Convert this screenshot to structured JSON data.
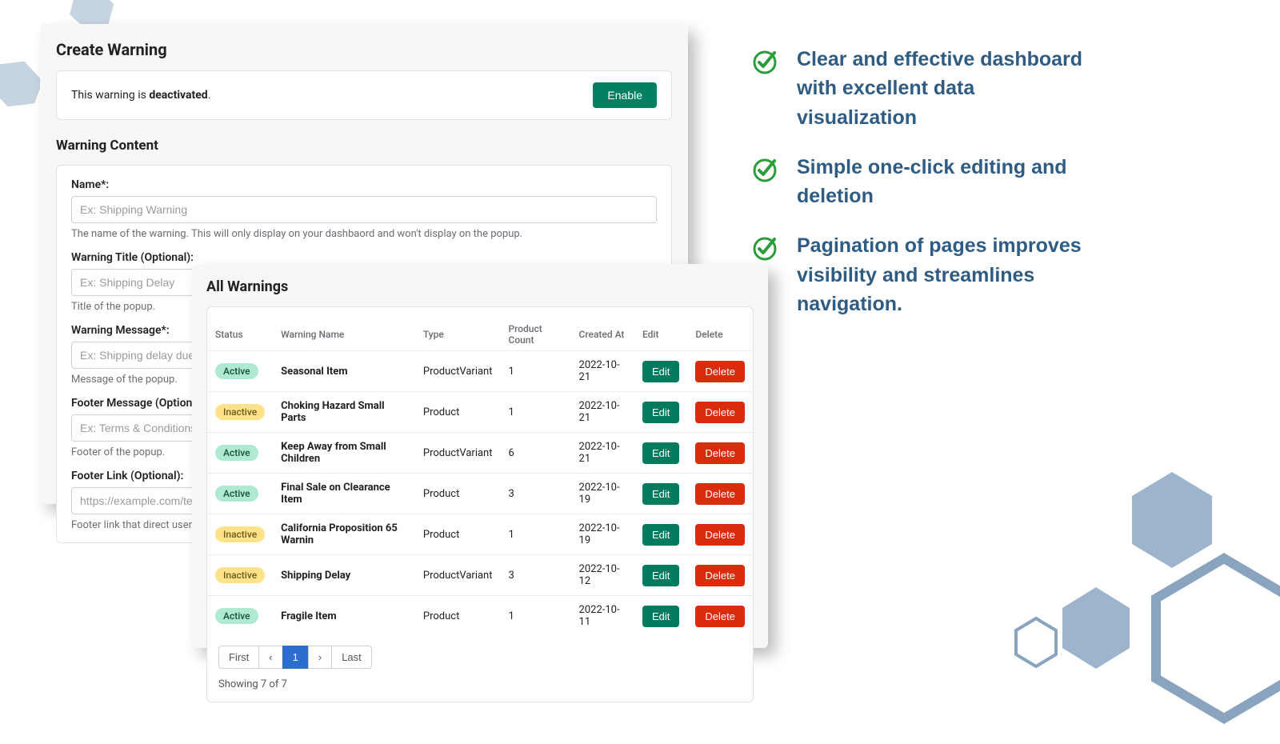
{
  "create_panel": {
    "title": "Create Warning",
    "status_prefix": "This warning is ",
    "status_word": "deactivated",
    "status_suffix": ".",
    "enable_label": "Enable",
    "section_title": "Warning Content",
    "fields": {
      "name": {
        "label": "Name*:",
        "placeholder": "Ex: Shipping Warning",
        "hint": "The name of the warning. This will only display on your dashbaord and won't display on the popup."
      },
      "title": {
        "label": "Warning Title (Optional):",
        "placeholder": "Ex: Shipping Delay",
        "hint": "Title of the popup."
      },
      "msg": {
        "label": "Warning Message*:",
        "placeholder": "Ex: Shipping delay due to ",
        "hint": "Message of the popup."
      },
      "footer": {
        "label": "Footer Message (Optional):",
        "placeholder": "Ex: Terms & Conditions",
        "hint": "Footer of the popup."
      },
      "link": {
        "label": "Footer Link (Optional):",
        "placeholder": "https://example.com/terms",
        "hint": "Footer link that direct user to"
      }
    }
  },
  "all_panel": {
    "title": "All Warnings",
    "headers": {
      "status": "Status",
      "name": "Warning Name",
      "type": "Type",
      "count": "Product Count",
      "created": "Created At",
      "edit": "Edit",
      "delete": "Delete"
    },
    "rows": [
      {
        "status": "Active",
        "name": "Seasonal Item",
        "type": "ProductVariant",
        "count": "1",
        "created": "2022-10-21"
      },
      {
        "status": "Inactive",
        "name": "Choking Hazard Small Parts",
        "type": "Product",
        "count": "1",
        "created": "2022-10-21"
      },
      {
        "status": "Active",
        "name": "Keep Away from Small Children",
        "type": "ProductVariant",
        "count": "6",
        "created": "2022-10-21"
      },
      {
        "status": "Active",
        "name": "Final Sale on Clearance Item",
        "type": "Product",
        "count": "3",
        "created": "2022-10-19"
      },
      {
        "status": "Inactive",
        "name": "California Proposition 65 Warnin",
        "type": "Product",
        "count": "1",
        "created": "2022-10-19"
      },
      {
        "status": "Inactive",
        "name": "Shipping Delay",
        "type": "ProductVariant",
        "count": "3",
        "created": "2022-10-12"
      },
      {
        "status": "Active",
        "name": "Fragile Item",
        "type": "Product",
        "count": "1",
        "created": "2022-10-11"
      }
    ],
    "edit_label": "Edit",
    "delete_label": "Delete",
    "pagination": {
      "first": "First",
      "prev": "‹",
      "page": "1",
      "next": "›",
      "last": "Last"
    },
    "summary": "Showing 7 of 7"
  },
  "bullets": [
    "Clear and effective dashboard with excellent data visualization",
    "Simple one-click editing and deletion",
    "Pagination of pages improves visibility and streamlines navigation."
  ]
}
